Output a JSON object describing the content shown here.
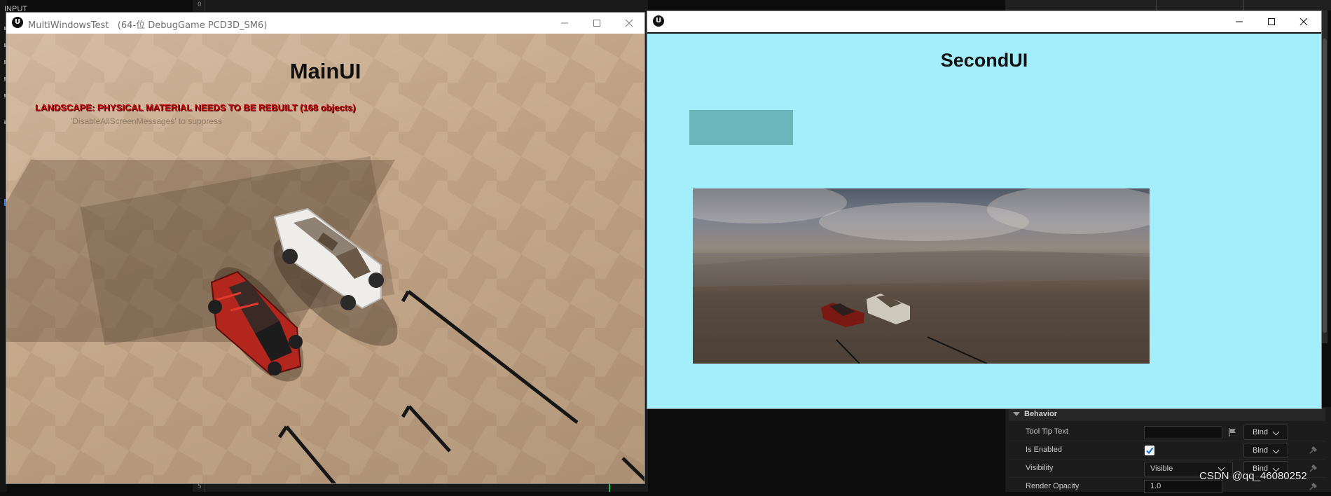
{
  "editor": {
    "input_label": "INPUT",
    "timeline_numbers": [
      "0",
      "5"
    ]
  },
  "main_window": {
    "title": "MultiWindowsTest   (64-位 DebugGame PCD3D_SM6)",
    "ui_title": "MainUI",
    "landscape_message": "LANDSCAPE: PHYSICAL MATERIAL NEEDS TO BE REBUILT (168 objects)",
    "suppress_message": "'DisableAllScreenMessages' to suppress"
  },
  "second_window": {
    "ui_title": "SecondUI"
  },
  "details_panel": {
    "section_title": "Behavior",
    "rows": [
      {
        "name": "Tool Tip Text",
        "bind": "Bind"
      },
      {
        "name": "Is Enabled",
        "bind": "Bind",
        "checked": true
      },
      {
        "name": "Visibility",
        "value": "Visible",
        "bind": "Bind"
      },
      {
        "name": "Render Opacity",
        "value": "1.0"
      }
    ]
  },
  "watermark": "CSDN @qq_46080252",
  "colors": {
    "second_ui_bg": "#a2eefb",
    "teal_box": "#6bb6bb",
    "landscape_warning": "#c30a0a",
    "editor_bg": "#1c1c1c"
  },
  "icons": [
    "ue-logo-icon",
    "minimize-icon",
    "maximize-icon",
    "close-icon",
    "flag-icon",
    "pin-icon",
    "chevron-down-icon",
    "checkmark-icon",
    "triangle-down-icon"
  ]
}
